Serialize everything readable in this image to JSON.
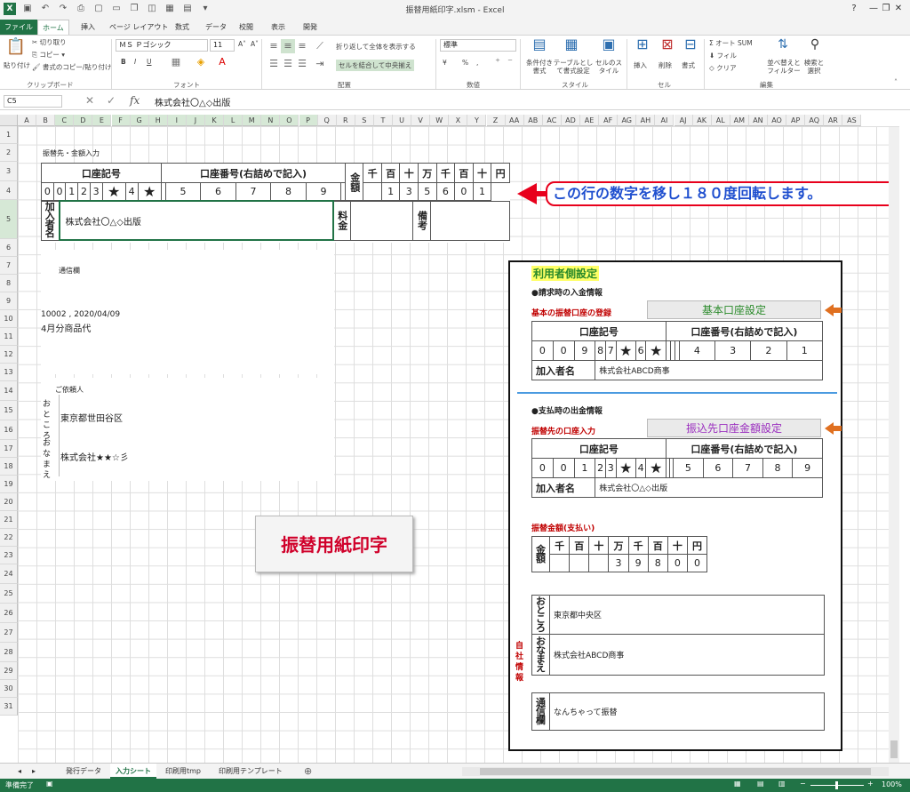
{
  "window": {
    "title": "振替用紙印字.xlsm - Excel",
    "help": "?",
    "minimize": "—",
    "restore": "❐",
    "close": "✕"
  },
  "tabs": [
    "ファイル",
    "ホーム",
    "挿入",
    "ページ レイアウト",
    "数式",
    "データ",
    "校閲",
    "表示",
    "開発"
  ],
  "ribbon": {
    "clipboard": {
      "paste": "貼り付け",
      "cut": "切り取り",
      "copy": "コピー ▾",
      "format_painter": "書式のコピー/貼り付け",
      "group": "クリップボード"
    },
    "font": {
      "name": "ＭＳ Ｐゴシック",
      "size": "11",
      "grow": "A˄",
      "shrink": "A˅",
      "bold": "B",
      "italic": "I",
      "underline": "U",
      "group": "フォント"
    },
    "align": {
      "wrap": "折り返して全体を表示する",
      "merge": "セルを結合して中央揃え",
      "group": "配置"
    },
    "number": {
      "format": "標準",
      "currency": "¥",
      "percent": "%",
      "comma": ",",
      "group": "数値"
    },
    "styles": {
      "cond": "条件付き書式",
      "table": "テーブルとして書式設定",
      "cell": "セルのスタイル",
      "group": "スタイル"
    },
    "cells": {
      "insert": "挿入",
      "delete": "削除",
      "format": "書式",
      "group": "セル"
    },
    "edit": {
      "autosum": "オート SUM",
      "fill": "フィル",
      "clear": "クリア",
      "sort": "並べ替えとフィルター",
      "find": "検索と選択",
      "group": "編集"
    }
  },
  "formula_bar": {
    "cell_ref": "C5",
    "content": "株式会社〇△◇出版",
    "fx": "fx",
    "cancel": "✕",
    "enter": "✓"
  },
  "columns": [
    "A",
    "B",
    "C",
    "D",
    "E",
    "F",
    "G",
    "H",
    "I",
    "J",
    "K",
    "L",
    "M",
    "N",
    "O",
    "P",
    "Q",
    "R",
    "S",
    "T",
    "U",
    "V",
    "W",
    "X",
    "Y",
    "Z",
    "AA",
    "AB",
    "AC",
    "AD",
    "AE",
    "AF",
    "AG",
    "AH",
    "AI",
    "AJ",
    "AK",
    "AL",
    "AM",
    "AN",
    "AO",
    "AP",
    "AQ",
    "AR",
    "AS"
  ],
  "rows": [
    "1",
    "2",
    "3",
    "4",
    "5",
    "6",
    "7",
    "8",
    "9",
    "10",
    "11",
    "12",
    "13",
    "14",
    "15",
    "16",
    "17",
    "18",
    "19",
    "20",
    "21",
    "22",
    "23",
    "24",
    "25",
    "26",
    "27",
    "28",
    "29",
    "30",
    "31"
  ],
  "sheet": {
    "header_label": "振替先・金額入力",
    "koza_kigo": "口座記号",
    "koza_bango": "口座番号(右詰めで記入)",
    "kingaku": "金額",
    "units": [
      "千",
      "百",
      "十",
      "万",
      "千",
      "百",
      "十",
      "円"
    ],
    "digits": [
      "0",
      "0",
      "1",
      "2",
      "3",
      "★",
      "4",
      "★",
      "",
      "5",
      "6",
      "7",
      "8",
      "9"
    ],
    "amount_digits": [
      "",
      "",
      "1",
      "3",
      "5",
      "6",
      "0",
      "1"
    ],
    "kanyu_label": "加入者名",
    "kanyu_value": "株式会社〇△◇出版",
    "ryokin": "料金",
    "biko": "備考",
    "tsushin_label": "通信欄",
    "tsushin_line1": "10002 , 2020/04/09",
    "tsushin_line2": "4月分商品代",
    "irai_label": "ご依頼人",
    "address_label": "おところ",
    "address_value": "東京都世田谷区",
    "name_label": "おなまえ",
    "name_value": "株式会社★★☆彡",
    "print_button": "振替用紙印字",
    "callout": "この行の数字を移し１８０度回転します。"
  },
  "panel": {
    "title": "利用者側設定",
    "sec1": "●請求時の入金情報",
    "basic_label": "基本の振替口座の登録",
    "basic_button": "基本口座設定",
    "koza_kigo": "口座記号",
    "koza_bango": "口座番号(右詰めで記入)",
    "digits1": [
      "0",
      "0",
      "9",
      "8",
      "7",
      "★",
      "6",
      "★",
      "",
      "",
      "",
      "4",
      "3",
      "2",
      "1"
    ],
    "kanyu_label": "加入者名",
    "kanyu1": "株式会社ABCD商事",
    "sec2": "●支払時の出金情報",
    "transfer_label": "振替先の口座入力",
    "transfer_button": "振込先口座金額設定",
    "digits2": [
      "0",
      "0",
      "1",
      "2",
      "3",
      "★",
      "4",
      "★",
      "",
      "",
      "5",
      "6",
      "7",
      "8",
      "9"
    ],
    "kanyu2": "株式会社〇△◇出版",
    "amount_label": "振替金額(支払い)",
    "kingaku": "金額",
    "units": [
      "千",
      "百",
      "十",
      "万",
      "千",
      "百",
      "十",
      "円"
    ],
    "amount_digits": [
      "",
      "",
      "",
      "3",
      "9",
      "8",
      "0",
      "0"
    ],
    "address_label": "おところ",
    "address_value": "東京都中央区",
    "name_label": "おなまえ",
    "name_value": "株式会社ABCD商事",
    "tsushin_label": "通信欄",
    "tsushin_value": "なんちゃって振替",
    "self_info": "自社情報"
  },
  "sheet_tabs": [
    "発行データ",
    "入力シート",
    "印刷用tmp",
    "印刷用テンプレート"
  ],
  "active_sheet": "入力シート",
  "status": {
    "ready": "準備完了",
    "zoom": "100%"
  },
  "colors": {
    "excel_green": "#217346",
    "accent_red": "#e8001c",
    "callout_blue": "#1f4fcf",
    "panel_yellow": "#ffff66",
    "arrow_orange": "#e07020"
  }
}
